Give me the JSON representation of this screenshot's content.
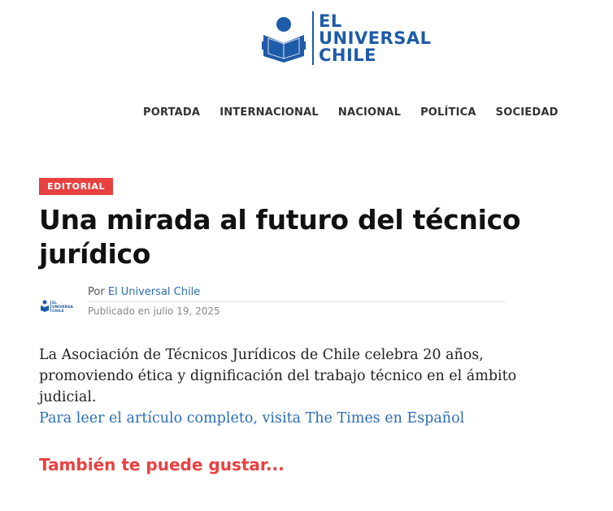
{
  "site": {
    "logo_line1": "EL",
    "logo_line2": "UNIVERSAL",
    "logo_line3": "CHILE",
    "brand_color": "#1e5ba8",
    "logo_icon": "reader-book-icon"
  },
  "nav": {
    "items": [
      {
        "label": "PORTADA"
      },
      {
        "label": "INTERNACIONAL"
      },
      {
        "label": "NACIONAL"
      },
      {
        "label": "POLÍTICA"
      },
      {
        "label": "SOCIEDAD"
      }
    ]
  },
  "article": {
    "category": "EDITORIAL",
    "category_color": "#e94040",
    "headline": "Una mirada al futuro del técnico jurídico",
    "byline": {
      "prefix": "Por",
      "author": "El Universal Chile",
      "published": "Publicado en julio 19, 2025"
    },
    "body": "La Asociación de Técnicos Jurídicos de Chile celebra 20 años, promoviendo ética y dignificación del trabajo técnico en el ámbito judicial.",
    "read_more": "Para leer el artículo completo, visita The Times en Español",
    "link_color": "#2a6db5"
  },
  "related": {
    "heading": "También te puede gustar..."
  }
}
